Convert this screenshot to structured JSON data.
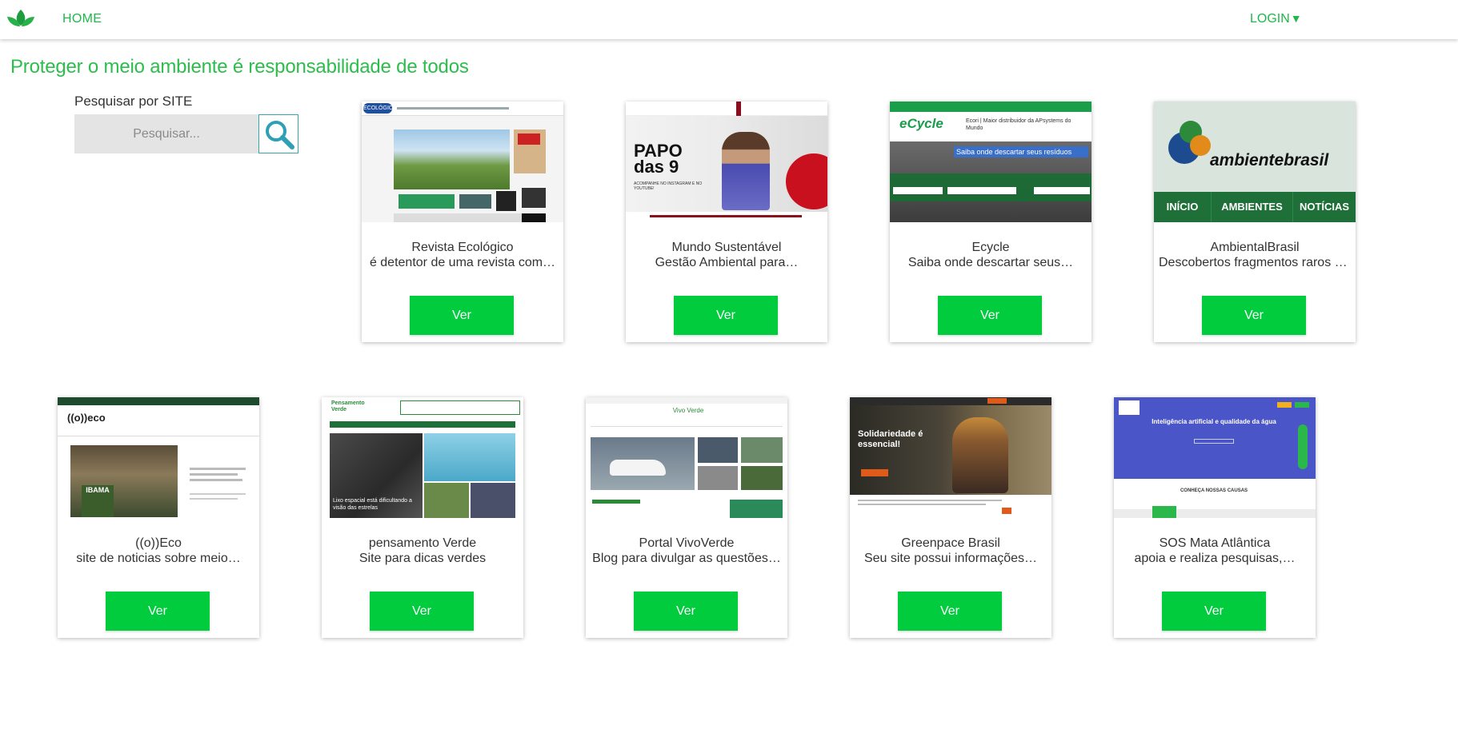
{
  "nav": {
    "home_label": "HOME",
    "login_label": "LOGIN",
    "login_caret": "▼",
    "logo_icon": "leaf-logo-icon"
  },
  "page": {
    "title": "Proteger o meio ambiente é responsabilidade de todos"
  },
  "search": {
    "label": "Pesquisar por SITE",
    "placeholder": "Pesquisar...",
    "button_icon": "search-icon"
  },
  "colors": {
    "brand_green": "#2ebd4c",
    "button_green": "#00cc3d",
    "search_border": "#36a6a6"
  },
  "cards": [
    {
      "title": "Revista Ecológico",
      "description": "é detentor de uma revista com…",
      "button": "Ver"
    },
    {
      "title": "Mundo Sustentável",
      "description": "Gestão Ambiental para…",
      "button": "Ver"
    },
    {
      "title": "Ecycle",
      "description": "Saiba onde descartar seus…",
      "button": "Ver"
    },
    {
      "title": "AmbientalBrasil",
      "description": "Descobertos fragmentos raros d…",
      "button": "Ver"
    },
    {
      "title": "((o))Eco",
      "description": "site de noticias sobre meio…",
      "button": "Ver"
    },
    {
      "title": "pensamento Verde",
      "description": "Site para dicas verdes",
      "button": "Ver"
    },
    {
      "title": "Portal VivoVerde",
      "description": "Blog para divulgar as questões…",
      "button": "Ver"
    },
    {
      "title": "Greenpace Brasil",
      "description": "Seu site possui informações…",
      "button": "Ver"
    },
    {
      "title": "SOS Mata Atlântica",
      "description": "apoia e realiza pesquisas,…",
      "button": "Ver"
    }
  ],
  "thumbnails": {
    "ecologico": {
      "logo": "ECOLÓGICO"
    },
    "mundo": {
      "headline": "PAPO das 9",
      "caption": "ACOMPANHE NO INSTAGRAM E NO YOUTUBE!"
    },
    "ecycle": {
      "logo": "eCycle",
      "tagline": "Ecori | Maior distribuidor da APsystems do Mundo",
      "banner": "Saiba onde descartar seus resíduos"
    },
    "ambiente": {
      "logo": "ambientebrasil",
      "menu": [
        "INÍCIO",
        "AMBIENTES",
        "NOTÍCIAS"
      ]
    },
    "oeco": {
      "logo": "((o))eco",
      "badge": "IBAMA"
    },
    "pensamento": {
      "logo": "Pensamento Verde",
      "caption": "Lixo espacial está dificultando a visão das estrelas"
    },
    "vivoverde": {
      "logo": "Vivo Verde"
    },
    "greenpeace": {
      "headline": "Solidariedade é essencial!"
    },
    "sos": {
      "headline": "Inteligência artificial e qualidade da água",
      "subhead": "CONHEÇA NOSSAS CAUSAS"
    }
  }
}
